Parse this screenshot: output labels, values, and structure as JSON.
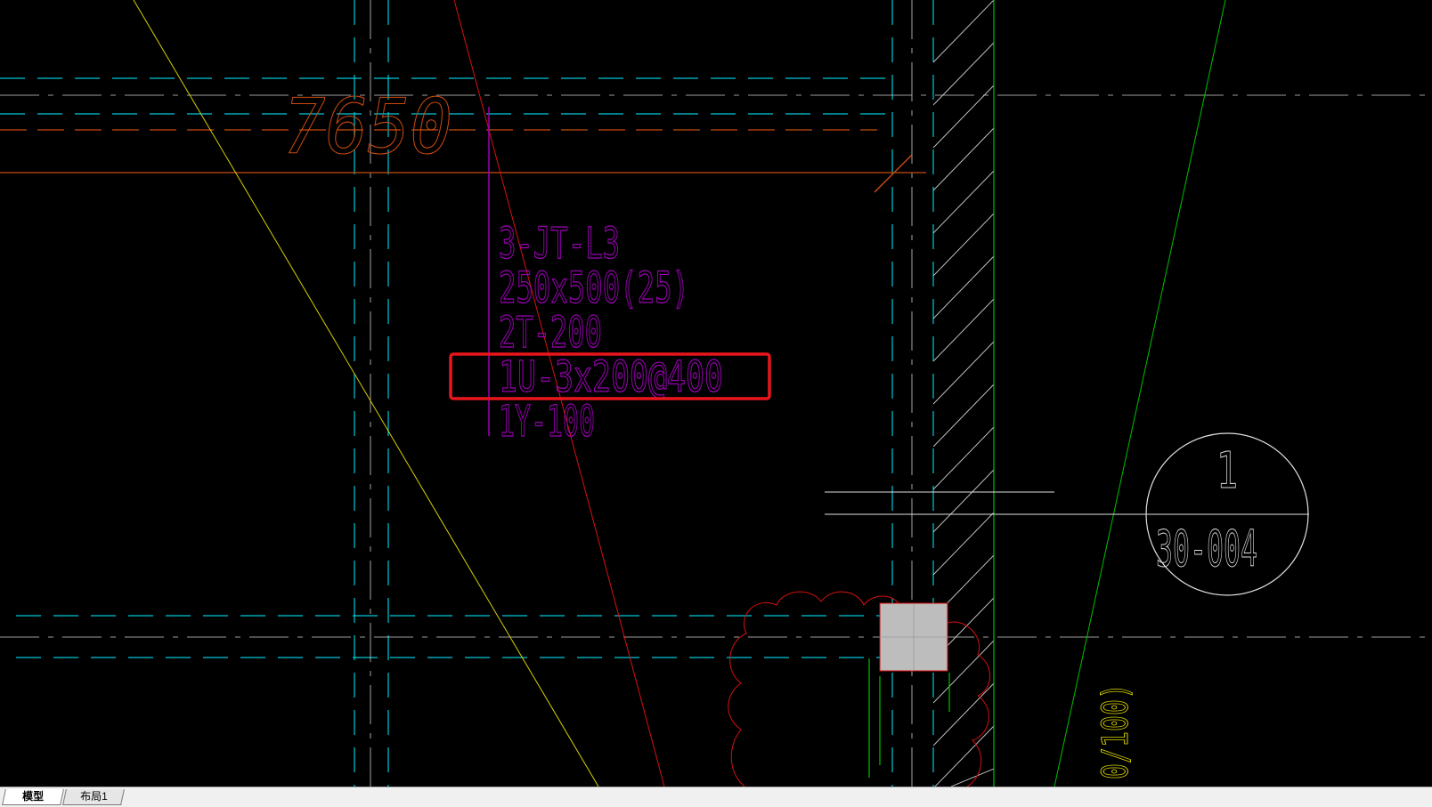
{
  "drawing": {
    "dimension_text": "7650",
    "beam_annotation": {
      "line1": "3-JT-L3",
      "line2": "250x500(25)",
      "line3": "2T-200",
      "line4_highlighted": "1U-3x200@400",
      "line5": "1Y-100"
    },
    "section_bubble": {
      "number": "1",
      "sheet": "30-004"
    },
    "rotated_label": "0/100)",
    "colors": {
      "background": "#000000",
      "cyan_dashed": "#00c8d8",
      "orange_dim": "#c84a10",
      "magenta_text": "#9b00b4",
      "highlight_box": "#e8161c",
      "yellow_line": "#d6d000",
      "red_line": "#d81010",
      "green_line": "#00c000",
      "white_line": "#e0e0e0",
      "column_fill": "#bdbdbd"
    }
  },
  "tabs": {
    "model": "模型",
    "layout1": "布局1"
  }
}
